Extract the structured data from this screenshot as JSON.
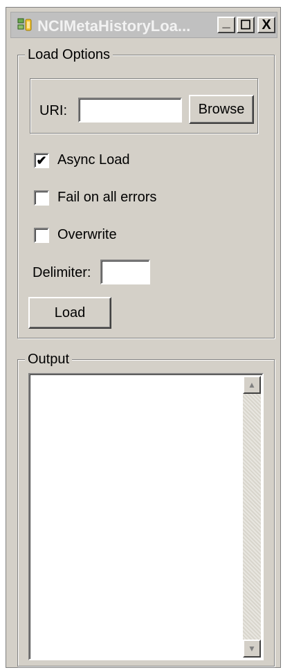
{
  "window": {
    "title": "NCIMetaHistoryLoa...",
    "controls": {
      "minimize": "_",
      "maximize": "☐",
      "close": "X"
    }
  },
  "load_options": {
    "legend": "Load Options",
    "uri_label": "URI:",
    "uri_value": "",
    "browse_label": "Browse",
    "async_load": {
      "label": "Async Load",
      "checked": true,
      "mark": "✔"
    },
    "fail_on_all_errors": {
      "label": "Fail on all errors",
      "checked": false,
      "mark": ""
    },
    "overwrite": {
      "label": "Overwrite",
      "checked": false,
      "mark": ""
    },
    "delimiter_label": "Delimiter:",
    "delimiter_value": "",
    "load_label": "Load"
  },
  "output": {
    "legend": "Output",
    "text": "",
    "scroll_up": "▲",
    "scroll_down": "▼"
  }
}
